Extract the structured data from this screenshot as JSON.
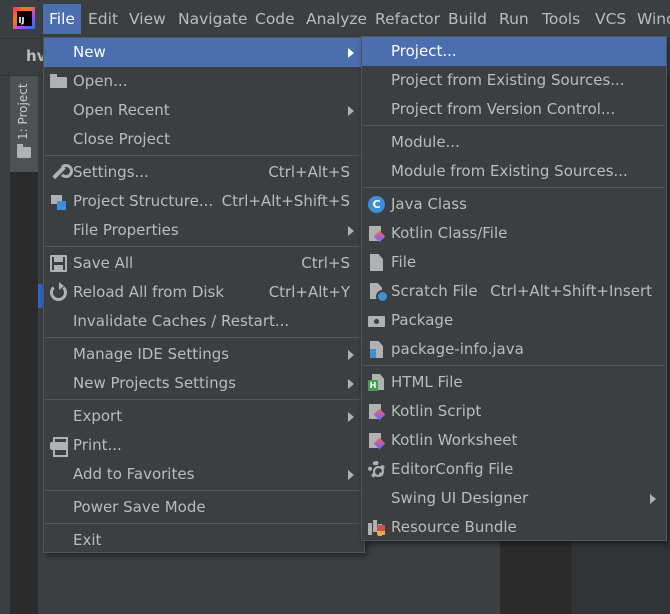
{
  "menubar": {
    "items": [
      "File",
      "Edit",
      "View",
      "Navigate",
      "Code",
      "Analyze",
      "Refactor",
      "Build",
      "Run",
      "Tools",
      "VCS",
      "Wind"
    ],
    "active": "File"
  },
  "project": {
    "name_fragment": "hv",
    "tool_window_label": "1: Project"
  },
  "file_menu": {
    "items": [
      {
        "label": "New",
        "shortcut": "",
        "submenu": true,
        "icon": "",
        "active": true
      },
      {
        "label": "Open...",
        "shortcut": "",
        "submenu": false,
        "icon": "folder-icon"
      },
      {
        "label": "Open Recent",
        "shortcut": "",
        "submenu": true,
        "icon": ""
      },
      {
        "label": "Close Project",
        "shortcut": "",
        "submenu": false,
        "icon": ""
      },
      {
        "label": "Settings...",
        "shortcut": "Ctrl+Alt+S",
        "submenu": false,
        "icon": "wrench-icon"
      },
      {
        "label": "Project Structure...",
        "shortcut": "Ctrl+Alt+Shift+S",
        "submenu": false,
        "icon": "project-structure-icon"
      },
      {
        "label": "File Properties",
        "shortcut": "",
        "submenu": true,
        "icon": ""
      },
      {
        "label": "Save All",
        "shortcut": "Ctrl+S",
        "submenu": false,
        "icon": "save-icon"
      },
      {
        "label": "Reload All from Disk",
        "shortcut": "Ctrl+Alt+Y",
        "submenu": false,
        "icon": "reload-icon"
      },
      {
        "label": "Invalidate Caches / Restart...",
        "shortcut": "",
        "submenu": false,
        "icon": ""
      },
      {
        "label": "Manage IDE Settings",
        "shortcut": "",
        "submenu": true,
        "icon": ""
      },
      {
        "label": "New Projects Settings",
        "shortcut": "",
        "submenu": true,
        "icon": ""
      },
      {
        "label": "Export",
        "shortcut": "",
        "submenu": true,
        "icon": ""
      },
      {
        "label": "Print...",
        "shortcut": "",
        "submenu": false,
        "icon": "print-icon"
      },
      {
        "label": "Add to Favorites",
        "shortcut": "",
        "submenu": true,
        "icon": ""
      },
      {
        "label": "Power Save Mode",
        "shortcut": "",
        "submenu": false,
        "icon": ""
      },
      {
        "label": "Exit",
        "shortcut": "",
        "submenu": false,
        "icon": ""
      }
    ]
  },
  "new_menu": {
    "items": [
      {
        "label": "Project...",
        "shortcut": "",
        "submenu": false,
        "icon": "",
        "active": true
      },
      {
        "label": "Project from Existing Sources...",
        "shortcut": "",
        "submenu": false,
        "icon": ""
      },
      {
        "label": "Project from Version Control...",
        "shortcut": "",
        "submenu": false,
        "icon": ""
      },
      {
        "label": "Module...",
        "shortcut": "",
        "submenu": false,
        "icon": ""
      },
      {
        "label": "Module from Existing Sources...",
        "shortcut": "",
        "submenu": false,
        "icon": ""
      },
      {
        "label": "Java Class",
        "shortcut": "",
        "submenu": false,
        "icon": "java-class-icon"
      },
      {
        "label": "Kotlin Class/File",
        "shortcut": "",
        "submenu": false,
        "icon": "kotlin-file-icon"
      },
      {
        "label": "File",
        "shortcut": "",
        "submenu": false,
        "icon": "file-icon"
      },
      {
        "label": "Scratch File",
        "shortcut": "Ctrl+Alt+Shift+Insert",
        "submenu": false,
        "icon": "scratch-file-icon"
      },
      {
        "label": "Package",
        "shortcut": "",
        "submenu": false,
        "icon": "package-icon"
      },
      {
        "label": "package-info.java",
        "shortcut": "",
        "submenu": false,
        "icon": "package-info-icon"
      },
      {
        "label": "HTML File",
        "shortcut": "",
        "submenu": false,
        "icon": "html-file-icon"
      },
      {
        "label": "Kotlin Script",
        "shortcut": "",
        "submenu": false,
        "icon": "kotlin-script-icon"
      },
      {
        "label": "Kotlin Worksheet",
        "shortcut": "",
        "submenu": false,
        "icon": "kotlin-worksheet-icon"
      },
      {
        "label": "EditorConfig File",
        "shortcut": "",
        "submenu": false,
        "icon": "gear-icon"
      },
      {
        "label": "Swing UI Designer",
        "shortcut": "",
        "submenu": true,
        "icon": ""
      },
      {
        "label": "Resource Bundle",
        "shortcut": "",
        "submenu": false,
        "icon": "resource-bundle-icon"
      }
    ]
  },
  "colors": {
    "menu_bg": "#3c3f41",
    "selection": "#4b6eaf",
    "text": "#bbbbbb",
    "separator": "#515658"
  }
}
